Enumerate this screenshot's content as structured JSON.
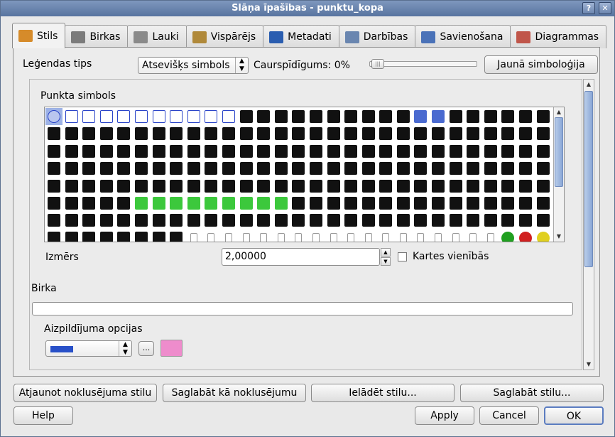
{
  "window": {
    "title": "Slāņa īpašības - punktu_kopa",
    "btn_help": "?",
    "btn_close": "✕"
  },
  "tabs": [
    {
      "label": "Stils",
      "icon": "brush-icon",
      "color": "#d68b2a"
    },
    {
      "label": "Birkas",
      "icon": "label-icon",
      "color": "#7b7b7b"
    },
    {
      "label": "Lauki",
      "icon": "table-icon",
      "color": "#8a8a8a"
    },
    {
      "label": "Vispārējs",
      "icon": "tools-icon",
      "color": "#b0893a"
    },
    {
      "label": "Metadati",
      "icon": "info-icon",
      "color": "#2a5db0"
    },
    {
      "label": "Darbības",
      "icon": "gears-icon",
      "color": "#6a86b0"
    },
    {
      "label": "Savienošana",
      "icon": "join-icon",
      "color": "#4a72b8"
    },
    {
      "label": "Diagrammas",
      "icon": "chart-icon",
      "color": "#c0564a"
    }
  ],
  "style": {
    "legend_type_label": "Leģendas tips",
    "legend_type_value": "Atsevišķs simbols",
    "transparency_label": "Caurspīdīgums: 0%",
    "transparency_value": 0,
    "new_symbology_button": "Jaunā simboloģija",
    "point_symbol_label": "Punkta simbols",
    "size_label": "Izmērs",
    "size_value": "2,00000",
    "map_units_label": "Kartes vienībās",
    "map_units_checked": false,
    "label_heading": "Birka",
    "label_value": "",
    "fill_options_label": "Aizpildījuma opcijas",
    "fill_color": "#2850c8",
    "fill_more_button": "...",
    "outline_color": "#ee8ccc"
  },
  "symbols": {
    "rows": 8,
    "cols": 29,
    "selected_index": 0
  },
  "footer": {
    "restore_default": "Atjaunot noklusējuma stilu",
    "save_default": "Saglabāt kā noklusējumu",
    "load_style": "Ielādēt stilu...",
    "save_style": "Saglabāt stilu...",
    "help": "Help",
    "apply": "Apply",
    "cancel": "Cancel",
    "ok": "OK"
  }
}
